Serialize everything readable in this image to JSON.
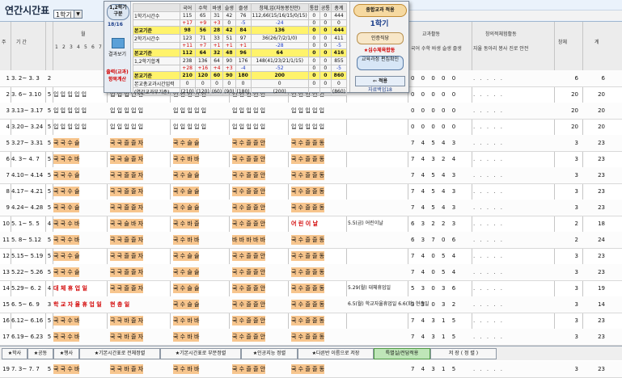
{
  "header": {
    "title": "연간시간표",
    "semester_value": "1학기"
  },
  "columns": {
    "num": "주",
    "period": "기  간",
    "week": "월",
    "weekdays": [
      "1",
      "2",
      "3",
      "4",
      "5",
      "6",
      "7"
    ],
    "subjects_header": "교과활동",
    "creative_header": "창의적체험활동",
    "stat_labels": "국어 수학 바생 슬생 즐생",
    "stat2_labels": "자율 동아리 봉사 진로 안전",
    "extra1": "창체",
    "extra2": "계"
  },
  "overlay": {
    "half_button": "1,2학기 구분",
    "half_count": "18/16",
    "show_label": "결과보기",
    "print_label": "출력(교과) 항목계산",
    "col_headers": [
      "국어",
      "수학",
      "바생",
      "슬생",
      "즐생",
      "창체,입(자동봉진안)",
      "통합",
      "공통",
      "총계"
    ],
    "rows": [
      {
        "label": "1학기시간수",
        "values": [
          "115",
          "65",
          "31",
          "42",
          "76",
          "112,66(15/16/15/0/15)",
          "0",
          "0",
          "444"
        ]
      },
      {
        "label": "",
        "values": [
          "+17",
          "+9",
          "+3",
          "0",
          "-5",
          "-24",
          "0",
          "0",
          "0"
        ]
      },
      {
        "label": "본교기준",
        "values": [
          "98",
          "56",
          "28",
          "42",
          "84",
          "136",
          "0",
          "0",
          "444"
        ]
      },
      {
        "label": "2학기시간수",
        "values": [
          "123",
          "71",
          "33",
          "51",
          "97",
          "36(26/7/2/1/0)",
          "0",
          "0",
          "411"
        ]
      },
      {
        "label": "",
        "values": [
          "+11",
          "+7",
          "+1",
          "+1",
          "+1",
          "-28",
          "0",
          "0",
          "-5"
        ]
      },
      {
        "label": "본교기준",
        "values": [
          "112",
          "64",
          "32",
          "48",
          "96",
          "64",
          "0",
          "0",
          "416"
        ]
      },
      {
        "label": "1,2학기합계",
        "values": [
          "238",
          "136",
          "64",
          "90",
          "176",
          "148(41/23/21/1/15)",
          "0",
          "0",
          "855"
        ]
      },
      {
        "label": "",
        "values": [
          "+28",
          "+16",
          "+4",
          "+3",
          "-4",
          "-52",
          "0",
          "0",
          "-5"
        ]
      },
      {
        "label": "본교기준",
        "values": [
          "210",
          "120",
          "60",
          "90",
          "180",
          "200",
          "0",
          "0",
          "860"
        ]
      },
      {
        "label": "본교총교과시간입력",
        "values": [
          "0",
          "0",
          "0",
          "0",
          "0",
          "0",
          "0",
          "0",
          "0"
        ]
      },
      {
        "label": "(연간교과부기준)",
        "values": [
          "(210)",
          "(120)",
          "(60)",
          "(90)",
          "(180)",
          "(200)",
          "",
          "",
          "(860)"
        ]
      }
    ],
    "right_title": "종합교과 적용",
    "semester_big": "1학기",
    "btn_apply": "인증직당",
    "red_text": "★심수체육합동",
    "btn_curriculum": "교육과정 편집확인",
    "sync_label": "적용",
    "version": "자료백업18"
  },
  "rows": [
    {
      "num": "1",
      "period": "3. 2~ 3. 3",
      "days": "2",
      "g1": "",
      "g2": "",
      "g3": "",
      "g4": "",
      "g5": "",
      "note": "",
      "stat": "0 0 0 0 0",
      "stat2": ". . . . .",
      "r1": "6",
      "r2": "6"
    },
    {
      "num": "2",
      "period": "3. 6~ 3.10",
      "days": "5",
      "g1": "입 입 입 입 입",
      "g2": "입 입 입 입 입",
      "g3": "입 입 입 입 입",
      "g4": "입 입 입 입 입",
      "g5": "입 입 입 입 입",
      "note": "",
      "stat": "0 0 0 0 0",
      "stat2": ". . . . .",
      "r1": "20",
      "r2": "20"
    },
    {
      "num": "3",
      "period": "3.13~ 3.17",
      "days": "5",
      "g1": "입 입 입 입 입",
      "g2": "입 입 입 입 입",
      "g3": "입 입 입 입 입",
      "g4": "입 입 입 입 입",
      "g5": "입 입 입 입 입",
      "note": "",
      "stat": "0 0 0 0 0",
      "stat2": ". . . . .",
      "r1": "20",
      "r2": "20"
    },
    {
      "num": "4",
      "period": "3.20~ 3.24",
      "days": "5",
      "g1": "입 입 입 입 입",
      "g2": "입 입 입 입 입",
      "g3": "입 입 입 입 입",
      "g4": "입 입 입 입 입",
      "g5": "입 입 입 입 입",
      "note": "",
      "stat": "0 0 0 0 0",
      "stat2": ". . . . .",
      "r1": "20",
      "r2": "20"
    },
    {
      "num": "5",
      "period": "3.27~ 3.31",
      "days": "5",
      "g1": "국 국 수 슬",
      "g2": "국 국 즐 즐 자",
      "g3": "국 수 슬 슬",
      "g4": "국 수 즐 즐 안",
      "g5": "국 수 즐 즐 동",
      "note": "",
      "stat": "7 4 5 4 3",
      "stat2": ". . . . .",
      "r1": "3",
      "r2": "23"
    },
    {
      "num": "6",
      "period": "4. 3~ 4. 7",
      "days": "5",
      "g1": "국 국 수 바",
      "g2": "국 국 슬 즐 자",
      "g3": "국 수 바 바",
      "g4": "국 수 즐 즐 안",
      "g5": "국 수 즐 즐 동",
      "note": "",
      "stat": "7 4 3 2 4",
      "stat2": ". . . . .",
      "r1": "3",
      "r2": "23"
    },
    {
      "num": "7",
      "period": "4.10~ 4.14",
      "days": "5",
      "g1": "국 국 수 슬",
      "g2": "국 국 즐 즐 자",
      "g3": "국 수 슬 슬",
      "g4": "국 수 즐 즐 안",
      "g5": "국 수 즐 즐 동",
      "note": "",
      "stat": "7 4 5 4 3",
      "stat2": ". . . . .",
      "r1": "3",
      "r2": "23"
    },
    {
      "num": "8",
      "period": "4.17~ 4.21",
      "days": "5",
      "g1": "국 국 수 슬",
      "g2": "국 국 즐 즐 자",
      "g3": "국 수 슬 슬",
      "g4": "국 수 즐 즐 안",
      "g5": "국 수 즐 즐 동",
      "note": "",
      "stat": "7 4 5 4 3",
      "stat2": ". . . . .",
      "r1": "3",
      "r2": "23"
    },
    {
      "num": "9",
      "period": "4.24~ 4.28",
      "days": "5",
      "g1": "국 국 수 슬",
      "g2": "국 국 즐 즐 자",
      "g3": "국 수 슬 슬",
      "g4": "국 수 즐 즐 안",
      "g5": "국 수 즐 즐 동",
      "note": "",
      "stat": "7 4 5 4 3",
      "stat2": ". . . . .",
      "r1": "3",
      "r2": "23"
    },
    {
      "num": "10",
      "period": "5. 1~ 5. 5",
      "days": "4",
      "g1": "국 국 수 바",
      "g2": "국 국 슬 바 자",
      "g3": "국 수 바 즐",
      "g4": "국 수 즐 즐 안",
      "g5": "어 린 이 날",
      "note": "5.5(금) 어린이날",
      "stat": "6 3 2 2 3",
      "stat2": ". . . . .",
      "r1": "2",
      "r2": "18"
    },
    {
      "num": "11",
      "period": "5. 8~ 5.12",
      "days": "5",
      "g1": "국 국 수 바",
      "g2": "국 국 즐 즐 자",
      "g3": "국 수 바 바",
      "g4": "바 바 바 바 바",
      "g5": "국 수 즐 즐 동",
      "note": "",
      "stat": "6 3 7 0 6",
      "stat2": ". . . . .",
      "r1": "2",
      "r2": "24"
    },
    {
      "num": "12",
      "period": "5.15~ 5.19",
      "days": "5",
      "g1": "국 국 수 슬",
      "g2": "국 국 즐 즐 자",
      "g3": "국 수 슬 슬",
      "g4": "국 수 즐 즐 안",
      "g5": "국 수 즐 즐 동",
      "note": "",
      "stat": "7 4 0 5 4",
      "stat2": ". . . . .",
      "r1": "3",
      "r2": "23"
    },
    {
      "num": "13",
      "period": "5.22~ 5.26",
      "days": "5",
      "g1": "국 국 수 슬",
      "g2": "국 국 즐 즐 자",
      "g3": "국 수 슬 슬",
      "g4": "국 수 즐 즐 안",
      "g5": "국 수 즐 즐 동",
      "note": "",
      "stat": "7 4 0 5 4",
      "stat2": ". . . . .",
      "r1": "3",
      "r2": "23"
    },
    {
      "num": "14",
      "period": "5.29~ 6. 2",
      "days": "4",
      "g1": "대 체 휴 업 일",
      "g2": "국 국 즐 즐 자",
      "g3": "국 수 슬 슬",
      "g4": "국 수 즐 즐 안",
      "g5": "국 수 즐 즐 동",
      "note": "5.29(월) 대체휴업일",
      "stat": "5 3 0 3 6",
      "stat2": ". . . . .",
      "r1": "3",
      "r2": "19"
    },
    {
      "num": "15",
      "period": "6. 5~ 6. 9",
      "days": "3",
      "g1": "학 교 자 율 휴 업 일",
      "g2": "현 충 일",
      "g3": "국 수 슬 슬",
      "g4": "국 수 즐 즐 안",
      "g5": "국 수 즐 즐 동",
      "note": "6.5(월) 학교자율휴업일 6.6(화) 현충일",
      "stat": "3 3 0 3 2",
      "stat2": ". . . . .",
      "r1": "3",
      "r2": "14"
    },
    {
      "num": "16",
      "period": "6.12~ 6.16",
      "days": "5",
      "g1": "국 국 수 바",
      "g2": "국 국 바 즐 자",
      "g3": "국 수 바 바",
      "g4": "국 수 즐 즐 안",
      "g5": "국 수 즐 즐 동",
      "note": "",
      "stat": "7 4 3 1 5",
      "stat2": ". . . . .",
      "r1": "3",
      "r2": "23"
    },
    {
      "num": "17",
      "period": "6.19~ 6.23",
      "days": "5",
      "g1": "국 국 수 바",
      "g2": "국 국 바 즐 자",
      "g3": "국 수 바 바",
      "g4": "국 수 즐 즐 안",
      "g5": "국 수 즐 즐 동",
      "note": "",
      "stat": "7 4 3 1 5",
      "stat2": ". . . . .",
      "r1": "3",
      "r2": "23"
    },
    {
      "num": "18",
      "period": "6.26~ 6.30",
      "days": "5",
      "g1": "국 국 수 바",
      "g2": "국 국 바 즐 자",
      "g3": "국 수 바 바",
      "g4": "국 수 즐 즐 안",
      "g5": "국 수 즐 즐 동",
      "note": "",
      "stat": "7 4 3 1 5",
      "stat2": ". . . . .",
      "r1": "3",
      "r2": "23"
    },
    {
      "num": "19",
      "period": "7. 3~ 7. 7",
      "days": "5",
      "g1": "국 국 수 바",
      "g2": "국 국 바 즐 자",
      "g3": "국 수 바 바",
      "g4": "국 수 즐 즐 안",
      "g5": "국 수 즐 즐 동",
      "note": "",
      "stat": "7 4 3 1 5",
      "stat2": ". . . . .",
      "r1": "3",
      "r2": "23"
    }
  ],
  "footer": {
    "btn_timetable": "★학사",
    "btn_common": "★공동",
    "btn_auto": "★행사",
    "btn_all": "★기본시간표로 전체정렬",
    "btn_partial": "★기본시간표로 부분정렬",
    "btn_cert": "★인공지능 정렬",
    "btn_other": "★다른반 이름으로 저장",
    "btn_special": "특별실/전담적용",
    "btn_save": "저 장 ( 정 렬 )"
  }
}
